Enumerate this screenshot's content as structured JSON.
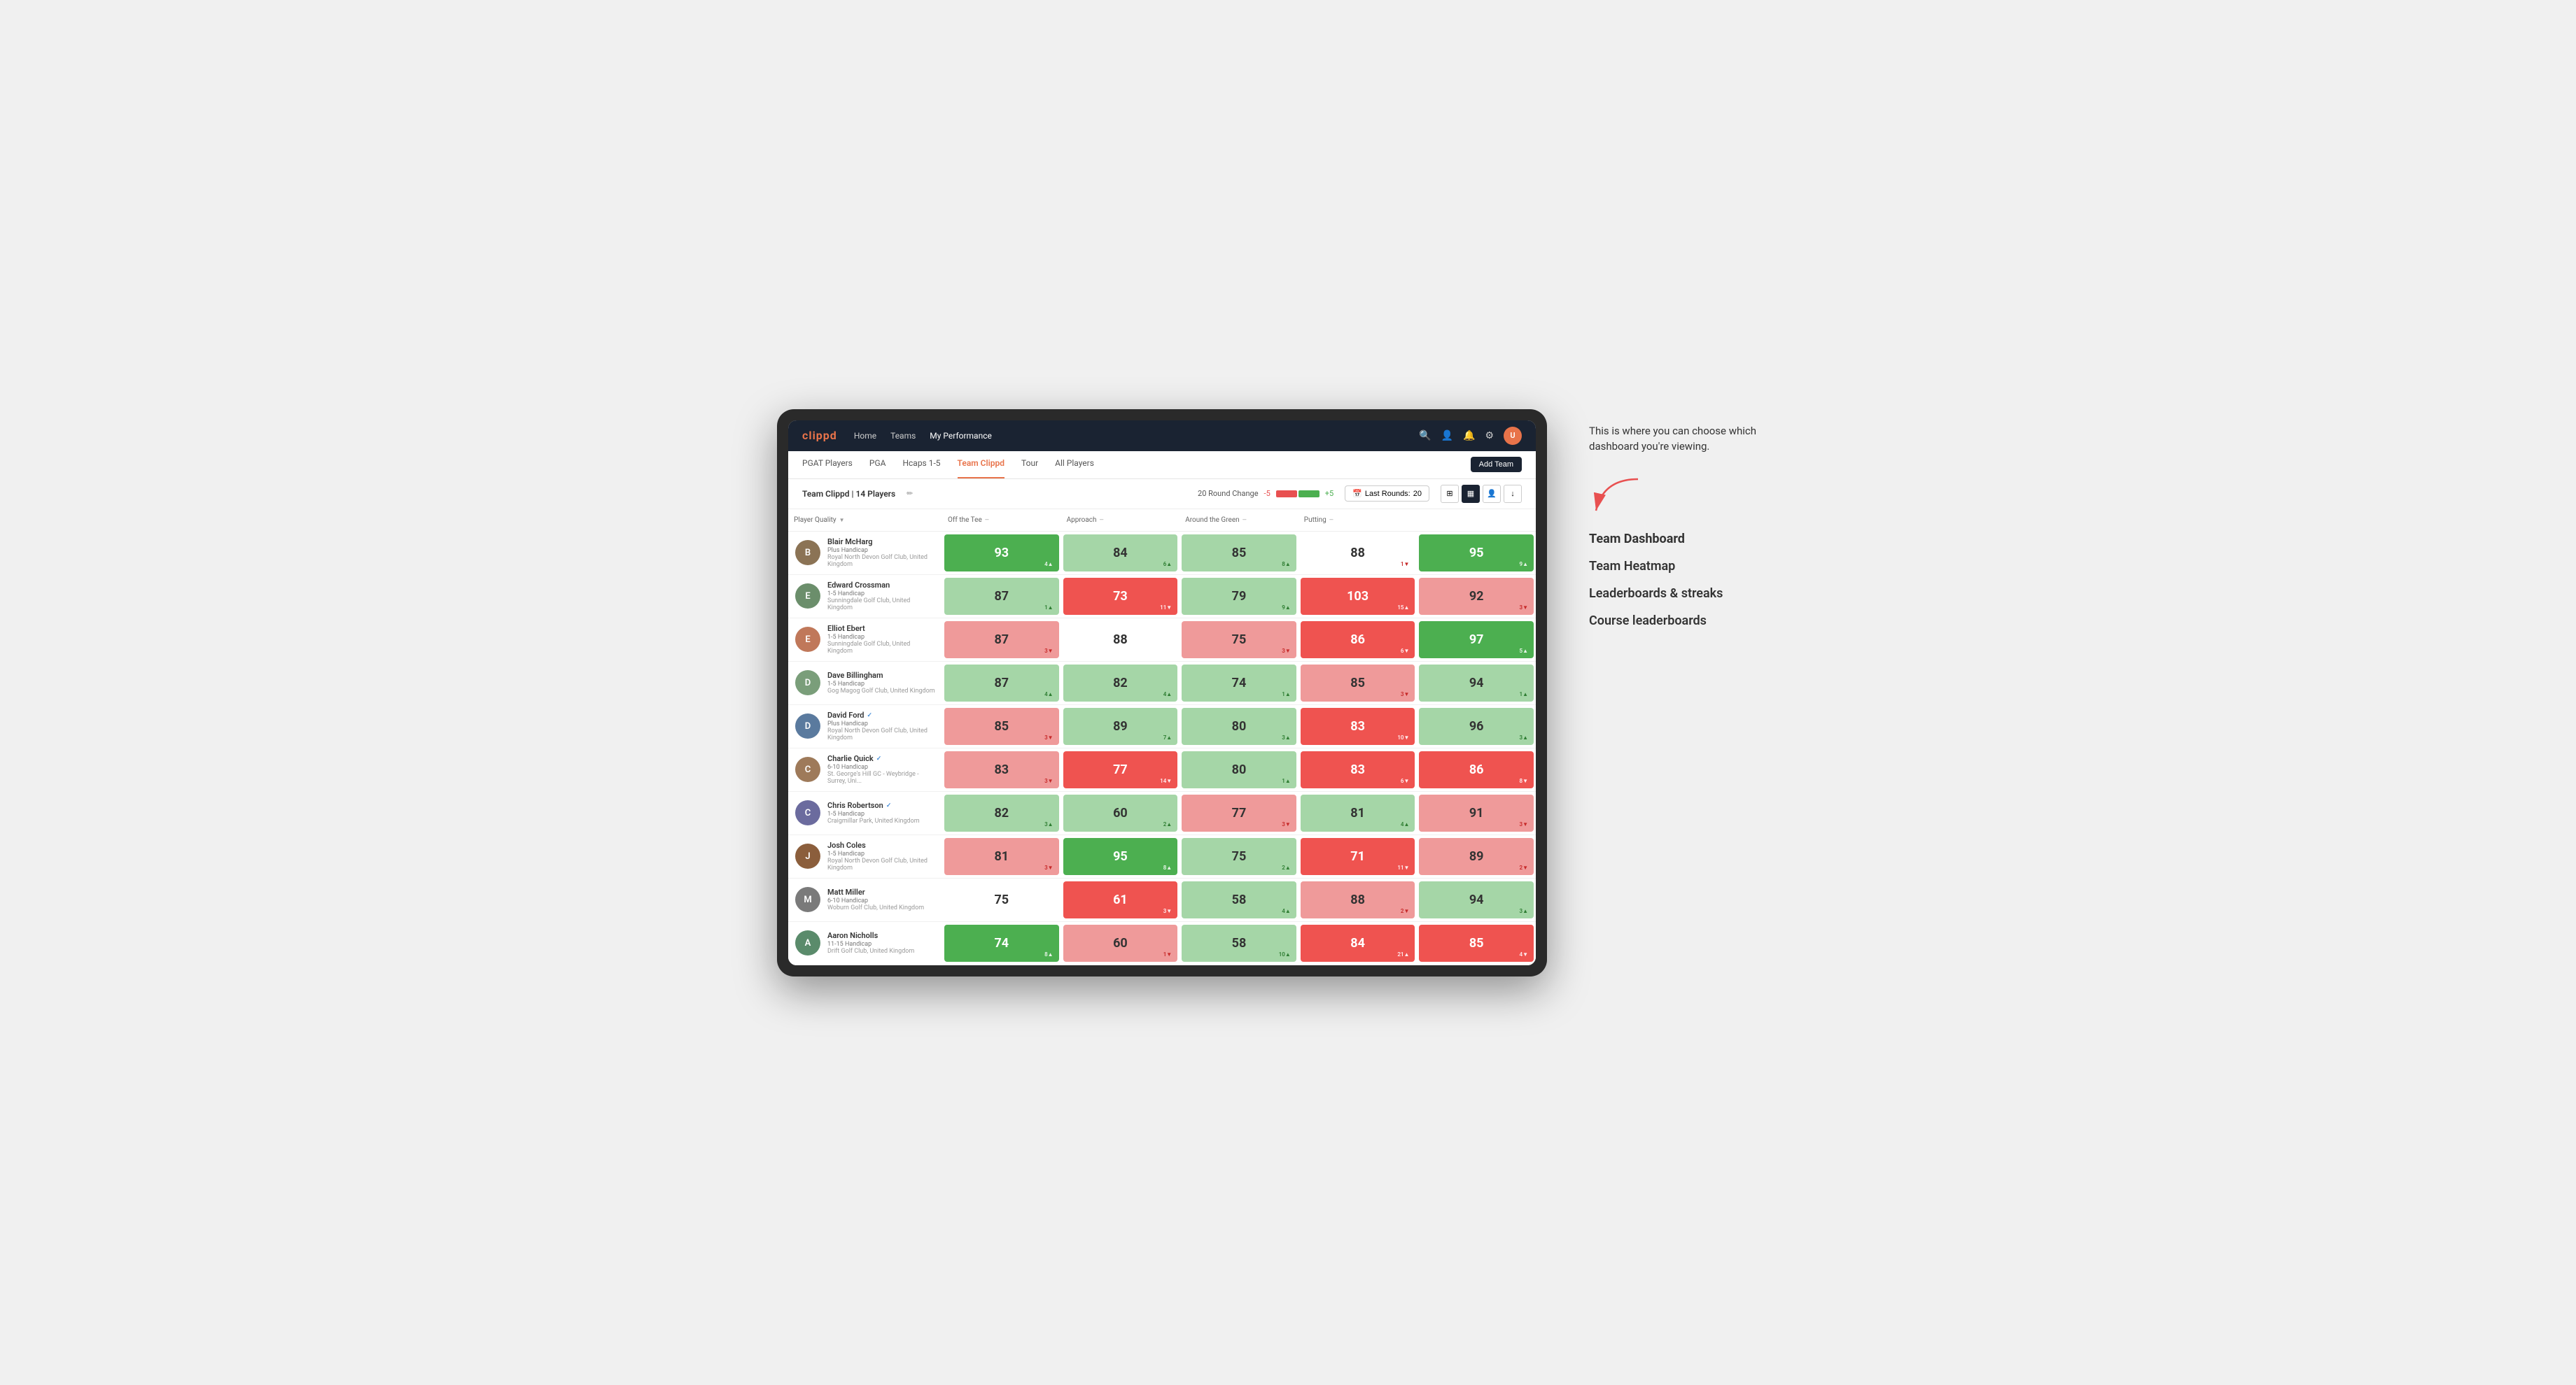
{
  "annotation": {
    "intro_text": "This is where you can choose which dashboard you're viewing.",
    "menu_items": [
      {
        "id": "team-dashboard",
        "label": "Team Dashboard",
        "active": true
      },
      {
        "id": "team-heatmap",
        "label": "Team Heatmap",
        "active": false
      },
      {
        "id": "leaderboards",
        "label": "Leaderboards & streaks",
        "active": false
      },
      {
        "id": "course-leaderboards",
        "label": "Course leaderboards",
        "active": false
      }
    ]
  },
  "nav": {
    "logo": "clippd",
    "links": [
      {
        "id": "home",
        "label": "Home",
        "active": false
      },
      {
        "id": "teams",
        "label": "Teams",
        "active": false
      },
      {
        "id": "my-performance",
        "label": "My Performance",
        "active": true
      }
    ],
    "add_team_label": "Add Team"
  },
  "sub_nav": {
    "tabs": [
      {
        "id": "pgat",
        "label": "PGAT Players",
        "active": false
      },
      {
        "id": "pga",
        "label": "PGA",
        "active": false
      },
      {
        "id": "hcaps",
        "label": "Hcaps 1-5",
        "active": false
      },
      {
        "id": "team-clippd",
        "label": "Team Clippd",
        "active": true
      },
      {
        "id": "tour",
        "label": "Tour",
        "active": false
      },
      {
        "id": "all-players",
        "label": "All Players",
        "active": false
      }
    ]
  },
  "team_header": {
    "name": "Team Clippd",
    "player_count": "14 Players",
    "round_change_label": "20 Round Change",
    "round_change_neg": "-5",
    "round_change_pos": "+5",
    "last_rounds_label": "Last Rounds:",
    "last_rounds_value": "20"
  },
  "table": {
    "columns": [
      {
        "id": "player",
        "label": "Player Quality"
      },
      {
        "id": "tee",
        "label": "Off the Tee"
      },
      {
        "id": "approach",
        "label": "Approach"
      },
      {
        "id": "around-green",
        "label": "Around the Green"
      },
      {
        "id": "putting",
        "label": "Putting"
      }
    ],
    "players": [
      {
        "id": 1,
        "name": "Blair McHarg",
        "handicap": "Plus Handicap",
        "club": "Royal North Devon Golf Club, United Kingdom",
        "avatar_color": "#8B7355",
        "avatar_letter": "B",
        "scores": [
          {
            "value": "93",
            "change": "4",
            "direction": "up",
            "color": "green-dark"
          },
          {
            "value": "84",
            "change": "6",
            "direction": "up",
            "color": "green-light"
          },
          {
            "value": "85",
            "change": "8",
            "direction": "up",
            "color": "green-light"
          },
          {
            "value": "88",
            "change": "1",
            "direction": "down",
            "color": "white"
          },
          {
            "value": "95",
            "change": "9",
            "direction": "up",
            "color": "green-dark"
          }
        ]
      },
      {
        "id": 2,
        "name": "Edward Crossman",
        "handicap": "1-5 Handicap",
        "club": "Sunningdale Golf Club, United Kingdom",
        "avatar_color": "#6B8E6B",
        "avatar_letter": "E",
        "scores": [
          {
            "value": "87",
            "change": "1",
            "direction": "up",
            "color": "green-light"
          },
          {
            "value": "73",
            "change": "11",
            "direction": "down",
            "color": "red-dark"
          },
          {
            "value": "79",
            "change": "9",
            "direction": "up",
            "color": "green-light"
          },
          {
            "value": "103",
            "change": "15",
            "direction": "up",
            "color": "red-dark"
          },
          {
            "value": "92",
            "change": "3",
            "direction": "down",
            "color": "red-light"
          }
        ]
      },
      {
        "id": 3,
        "name": "Elliot Ebert",
        "handicap": "1-5 Handicap",
        "club": "Sunningdale Golf Club, United Kingdom",
        "avatar_color": "#c0785a",
        "avatar_letter": "E",
        "scores": [
          {
            "value": "87",
            "change": "3",
            "direction": "down",
            "color": "red-light"
          },
          {
            "value": "88",
            "change": "",
            "direction": "none",
            "color": "white"
          },
          {
            "value": "75",
            "change": "3",
            "direction": "down",
            "color": "red-light"
          },
          {
            "value": "86",
            "change": "6",
            "direction": "down",
            "color": "red-dark"
          },
          {
            "value": "97",
            "change": "5",
            "direction": "up",
            "color": "green-dark"
          }
        ]
      },
      {
        "id": 4,
        "name": "Dave Billingham",
        "handicap": "1-5 Handicap",
        "club": "Gog Magog Golf Club, United Kingdom",
        "avatar_color": "#7a9e7a",
        "avatar_letter": "D",
        "scores": [
          {
            "value": "87",
            "change": "4",
            "direction": "up",
            "color": "green-light"
          },
          {
            "value": "82",
            "change": "4",
            "direction": "up",
            "color": "green-light"
          },
          {
            "value": "74",
            "change": "1",
            "direction": "up",
            "color": "green-light"
          },
          {
            "value": "85",
            "change": "3",
            "direction": "down",
            "color": "red-light"
          },
          {
            "value": "94",
            "change": "1",
            "direction": "up",
            "color": "green-light"
          }
        ]
      },
      {
        "id": 5,
        "name": "David Ford",
        "handicap": "Plus Handicap",
        "club": "Royal North Devon Golf Club, United Kingdom",
        "avatar_color": "#5a7a9e",
        "avatar_letter": "D",
        "verified": true,
        "scores": [
          {
            "value": "85",
            "change": "3",
            "direction": "down",
            "color": "red-light"
          },
          {
            "value": "89",
            "change": "7",
            "direction": "up",
            "color": "green-light"
          },
          {
            "value": "80",
            "change": "3",
            "direction": "up",
            "color": "green-light"
          },
          {
            "value": "83",
            "change": "10",
            "direction": "down",
            "color": "red-dark"
          },
          {
            "value": "96",
            "change": "3",
            "direction": "up",
            "color": "green-light"
          }
        ]
      },
      {
        "id": 6,
        "name": "Charlie Quick",
        "handicap": "6-10 Handicap",
        "club": "St. George's Hill GC - Weybridge - Surrey, Uni...",
        "avatar_color": "#9e7a5a",
        "avatar_letter": "C",
        "verified": true,
        "scores": [
          {
            "value": "83",
            "change": "3",
            "direction": "down",
            "color": "red-light"
          },
          {
            "value": "77",
            "change": "14",
            "direction": "down",
            "color": "red-dark"
          },
          {
            "value": "80",
            "change": "1",
            "direction": "up",
            "color": "green-light"
          },
          {
            "value": "83",
            "change": "6",
            "direction": "down",
            "color": "red-dark"
          },
          {
            "value": "86",
            "change": "8",
            "direction": "down",
            "color": "red-dark"
          }
        ]
      },
      {
        "id": 7,
        "name": "Chris Robertson",
        "handicap": "1-5 Handicap",
        "club": "Craigmillar Park, United Kingdom",
        "avatar_color": "#6b6b9e",
        "avatar_letter": "C",
        "verified": true,
        "scores": [
          {
            "value": "82",
            "change": "3",
            "direction": "up",
            "color": "green-light"
          },
          {
            "value": "60",
            "change": "2",
            "direction": "up",
            "color": "green-light"
          },
          {
            "value": "77",
            "change": "3",
            "direction": "down",
            "color": "red-light"
          },
          {
            "value": "81",
            "change": "4",
            "direction": "up",
            "color": "green-light"
          },
          {
            "value": "91",
            "change": "3",
            "direction": "down",
            "color": "red-light"
          }
        ]
      },
      {
        "id": 8,
        "name": "Josh Coles",
        "handicap": "1-5 Handicap",
        "club": "Royal North Devon Golf Club, United Kingdom",
        "avatar_color": "#8B5E3C",
        "avatar_letter": "J",
        "scores": [
          {
            "value": "81",
            "change": "3",
            "direction": "down",
            "color": "red-light"
          },
          {
            "value": "95",
            "change": "8",
            "direction": "up",
            "color": "green-dark"
          },
          {
            "value": "75",
            "change": "2",
            "direction": "up",
            "color": "green-light"
          },
          {
            "value": "71",
            "change": "11",
            "direction": "down",
            "color": "red-dark"
          },
          {
            "value": "89",
            "change": "2",
            "direction": "down",
            "color": "red-light"
          }
        ]
      },
      {
        "id": 9,
        "name": "Matt Miller",
        "handicap": "6-10 Handicap",
        "club": "Woburn Golf Club, United Kingdom",
        "avatar_color": "#7a7a7a",
        "avatar_letter": "M",
        "scores": [
          {
            "value": "75",
            "change": "",
            "direction": "none",
            "color": "white"
          },
          {
            "value": "61",
            "change": "3",
            "direction": "down",
            "color": "red-dark"
          },
          {
            "value": "58",
            "change": "4",
            "direction": "up",
            "color": "green-light"
          },
          {
            "value": "88",
            "change": "2",
            "direction": "down",
            "color": "red-light"
          },
          {
            "value": "94",
            "change": "3",
            "direction": "up",
            "color": "green-light"
          }
        ]
      },
      {
        "id": 10,
        "name": "Aaron Nicholls",
        "handicap": "11-15 Handicap",
        "club": "Drift Golf Club, United Kingdom",
        "avatar_color": "#5a8B6b",
        "avatar_letter": "A",
        "scores": [
          {
            "value": "74",
            "change": "8",
            "direction": "up",
            "color": "green-dark"
          },
          {
            "value": "60",
            "change": "1",
            "direction": "down",
            "color": "red-light"
          },
          {
            "value": "58",
            "change": "10",
            "direction": "up",
            "color": "green-light"
          },
          {
            "value": "84",
            "change": "21",
            "direction": "up",
            "color": "red-dark"
          },
          {
            "value": "85",
            "change": "4",
            "direction": "down",
            "color": "red-dark"
          }
        ]
      }
    ]
  }
}
